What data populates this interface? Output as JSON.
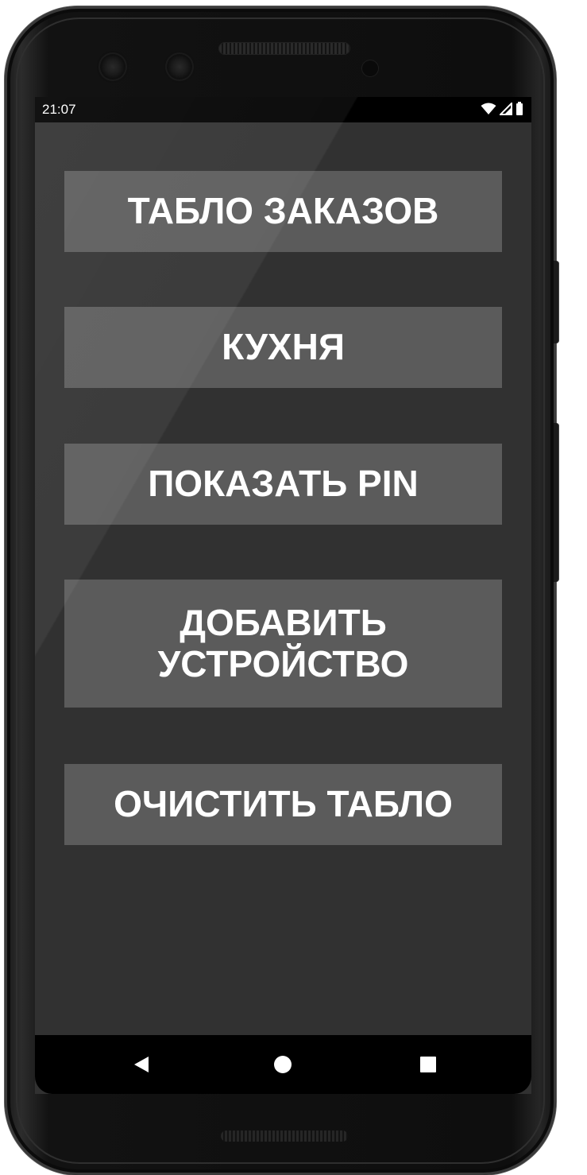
{
  "status_bar": {
    "time": "21:07",
    "icons": [
      "wifi-icon",
      "signal-icon",
      "battery-icon"
    ]
  },
  "menu": {
    "buttons": [
      {
        "label": "ТАБЛО ЗАКАЗОВ"
      },
      {
        "label": "КУХНЯ"
      },
      {
        "label": "ПОКАЗАТЬ PIN"
      },
      {
        "label": "ДОБАВИТЬ УСТРОЙСТВО"
      },
      {
        "label": "ОЧИСТИТЬ ТАБЛО"
      }
    ]
  },
  "nav_bar": {
    "icons": [
      "back-icon",
      "home-icon",
      "recents-icon"
    ]
  },
  "colors": {
    "screen_background": "#313131",
    "button_background": "#5b5b5b",
    "button_text": "#ffffff",
    "bars": "#000000"
  }
}
